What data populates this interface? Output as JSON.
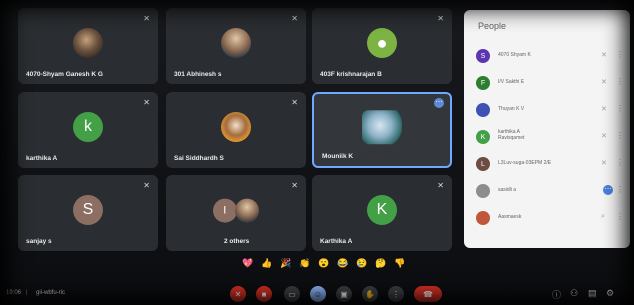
{
  "tiles": [
    {
      "name": "4070-Shyam Ganesh K G",
      "avatar": "",
      "avatar_color": "#7a6a58"
    },
    {
      "name": "301 Abhinesh s",
      "avatar": "",
      "avatar_color": "#6b7a86"
    },
    {
      "name": "403F krishnarajan B",
      "avatar": "",
      "avatar_color": "#7cb342"
    },
    {
      "name": "karthika A",
      "avatar": "k",
      "avatar_color": "#43a047"
    },
    {
      "name": "Sai Siddhardh S",
      "avatar": "",
      "avatar_color": "#e0912e"
    },
    {
      "name": "Mouniik K",
      "avatar": "",
      "avatar_color": "#5f8b8b"
    },
    {
      "name": "sanjay s",
      "avatar": "S",
      "avatar_color": "#8d6e63"
    },
    {
      "name": "2 others",
      "avatar": "I",
      "avatar_color": "#8d6e63"
    },
    {
      "name": "Karthika A",
      "avatar": "K",
      "avatar_color": "#43a047"
    }
  ],
  "people": {
    "title": "People",
    "list": [
      {
        "avatar": "S",
        "color": "#5e35b1",
        "name": "4070 Shyam K"
      },
      {
        "avatar": "F",
        "color": "#2e7d32",
        "name": "I/V Sakthi E"
      },
      {
        "avatar": "",
        "color": "#3f51b5",
        "name": "Thuyan K V"
      },
      {
        "avatar": "K",
        "color": "#43a047",
        "name": "karthika A\nRavisqamet"
      },
      {
        "avatar": "L",
        "color": "#6d4c41",
        "name": "L3Luv-suga-03EPM 2/E"
      },
      {
        "avatar": "",
        "color": "#8d8d8d",
        "name": "sasidli a"
      },
      {
        "avatar": "",
        "color": "#c0573a",
        "name": "Aasmaesk"
      }
    ]
  },
  "reactions": [
    "💖",
    "👍",
    "🎉",
    "👏",
    "😮",
    "😂",
    "😢",
    "🤔",
    "👎"
  ],
  "bottom_bar": {
    "time": "19:06",
    "separator": "|",
    "meeting_code": "gii-wbfu-ric"
  },
  "colors": {
    "end_call": "#d93025",
    "accent": "#8ab4f8",
    "highlight_border": "#6fa8ff"
  }
}
